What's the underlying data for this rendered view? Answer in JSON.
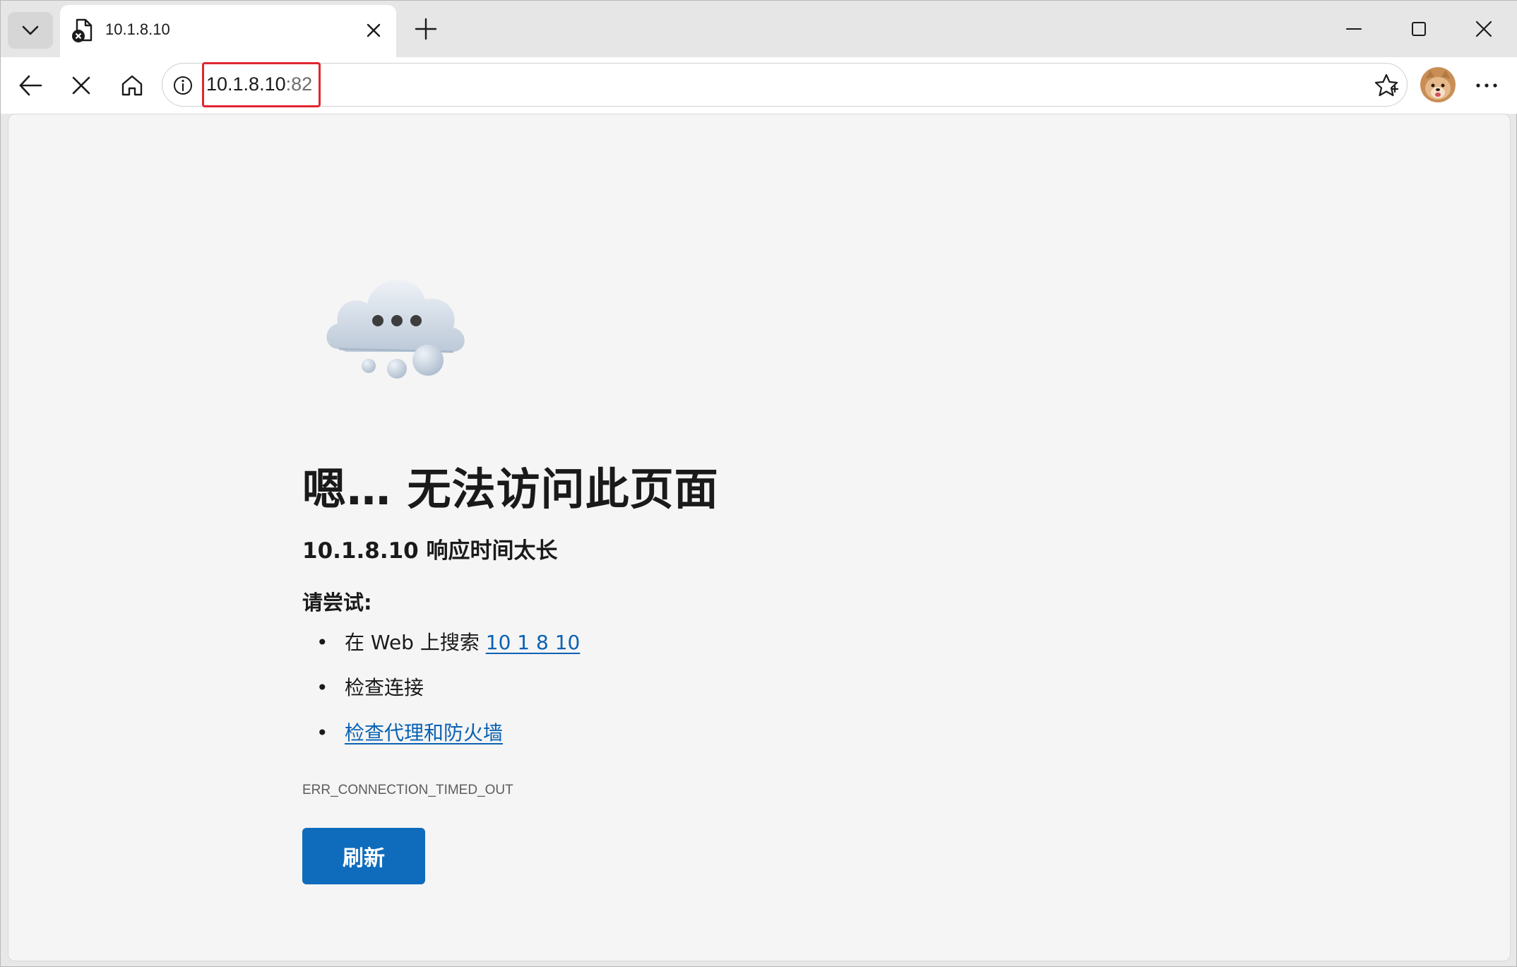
{
  "tab": {
    "title": "10.1.8.10"
  },
  "address": {
    "host": "10.1.8.10",
    "port": ":82"
  },
  "error_page": {
    "heading": "嗯… 无法访问此页面",
    "subheading": "10.1.8.10 响应时间太长",
    "try_label": "请尝试:",
    "suggestions": [
      {
        "prefix": "在 Web 上搜索 ",
        "link": "10 1 8 10"
      },
      {
        "prefix": "检查连接",
        "link": ""
      },
      {
        "prefix": "",
        "link": "检查代理和防火墙"
      }
    ],
    "error_code": "ERR_CONNECTION_TIMED_OUT",
    "refresh_label": "刷新"
  },
  "icons": {
    "tab_menu": "chevron-down-icon",
    "favicon": "page-error-icon",
    "tab_close": "close-icon",
    "new_tab": "plus-icon",
    "minimize": "minimize-icon",
    "maximize": "maximize-icon",
    "window_close": "close-icon",
    "back": "arrow-left-icon",
    "stop": "close-icon",
    "home": "home-icon",
    "site_info": "info-icon",
    "favorite": "star-icon",
    "more": "more-icon",
    "cloud": "cloud-icon"
  },
  "colors": {
    "accent": "#0f6cbd",
    "link": "#0a62b3",
    "highlight": "#e0262f"
  }
}
